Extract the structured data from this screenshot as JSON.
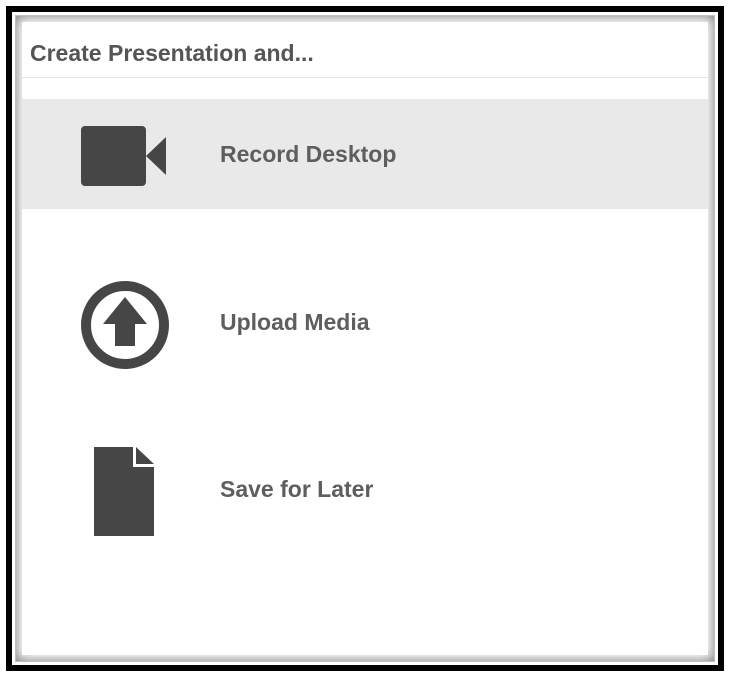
{
  "header": {
    "title": "Create Presentation and..."
  },
  "menu": {
    "items": [
      {
        "label": "Record Desktop",
        "icon": "video-camera-icon",
        "selected": true
      },
      {
        "label": "Upload Media",
        "icon": "upload-circle-arrow-icon",
        "selected": false
      },
      {
        "label": "Save for Later",
        "icon": "document-icon",
        "selected": false
      }
    ]
  },
  "colors": {
    "icon": "#464646",
    "label": "#5e5e5e",
    "selected_background": "#e9e9e9",
    "frame": "#000000"
  }
}
